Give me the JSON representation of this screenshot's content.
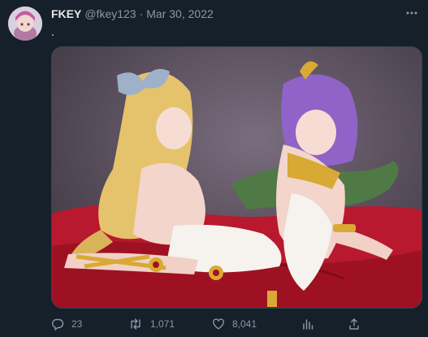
{
  "user": {
    "display_name": "FKEY",
    "handle": "@fkey123",
    "separator": "·",
    "date": "Mar 30, 2022"
  },
  "tweet": {
    "text": "."
  },
  "actions": {
    "replies": "23",
    "retweets": "1,071",
    "likes": "8,041"
  },
  "icons": {
    "more": "more-horizontal-icon",
    "reply": "reply-icon",
    "retweet": "retweet-icon",
    "like": "heart-icon",
    "stats": "bar-chart-icon",
    "share": "share-icon"
  },
  "colors": {
    "background": "#15202b",
    "text": "#e7e9ea",
    "muted": "#8b98a5",
    "border": "#38444d"
  }
}
